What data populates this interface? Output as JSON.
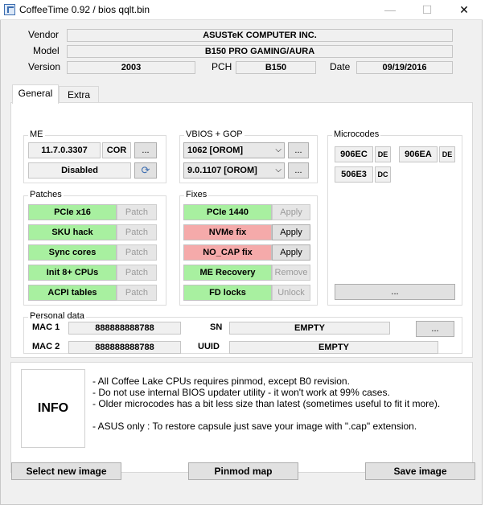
{
  "window": {
    "title": "CoffeeTime 0.92  /  bios qqlt.bin",
    "minimize_glyph": "—",
    "maximize_glyph": "☐",
    "close_glyph": "✕"
  },
  "header": {
    "vendor_label": "Vendor",
    "vendor_value": "ASUSTeK COMPUTER INC.",
    "model_label": "Model",
    "model_value": "B150 PRO GAMING/AURA",
    "version_label": "Version",
    "version_value": "2003",
    "pch_label": "PCH",
    "pch_value": "B150",
    "date_label": "Date",
    "date_value": "09/19/2016"
  },
  "tabs": [
    {
      "label": "General",
      "active": true
    },
    {
      "label": "Extra",
      "active": false
    }
  ],
  "me": {
    "title": "ME",
    "version": "11.7.0.3307",
    "type": "COR",
    "more_label": "...",
    "state": "Disabled",
    "refresh_icon": "⟳"
  },
  "vbios": {
    "title": "VBIOS + GOP",
    "vbios_value": "1062 [OROM]",
    "gop_value": "9.0.1107 [OROM]",
    "more_label": "...",
    "chevron": "⌵"
  },
  "microcodes": {
    "title": "Microcodes",
    "items": [
      {
        "cpuid": "906EC",
        "tag": "DE"
      },
      {
        "cpuid": "906EA",
        "tag": "DE"
      },
      {
        "cpuid": "506E3",
        "tag": "DC"
      }
    ],
    "more_label": "..."
  },
  "patches": {
    "title": "Patches",
    "items": [
      {
        "name": "PCIe x16",
        "action": "Patch"
      },
      {
        "name": "SKU hack",
        "action": "Patch"
      },
      {
        "name": "Sync cores",
        "action": "Patch"
      },
      {
        "name": "Init 8+ CPUs",
        "action": "Patch"
      },
      {
        "name": "ACPI tables",
        "action": "Patch"
      }
    ]
  },
  "fixes": {
    "title": "Fixes",
    "items": [
      {
        "name": "PCIe 1440",
        "action": "Apply",
        "status": "ok"
      },
      {
        "name": "NVMe fix",
        "action": "Apply",
        "status": "needed"
      },
      {
        "name": "NO_CAP fix",
        "action": "Apply",
        "status": "needed"
      },
      {
        "name": "ME Recovery",
        "action": "Remove",
        "status": "ok"
      },
      {
        "name": "FD locks",
        "action": "Unlock",
        "status": "ok"
      }
    ]
  },
  "personal": {
    "title": "Personal data",
    "mac1_label": "MAC 1",
    "mac1_value": "888888888788",
    "mac2_label": "MAC 2",
    "mac2_value": "888888888788",
    "sn_label": "SN",
    "sn_value": "EMPTY",
    "uuid_label": "UUID",
    "uuid_value": "EMPTY",
    "more_label": "..."
  },
  "info": {
    "label": "INFO",
    "lines": [
      "- All Coffee Lake CPUs requires pinmod, except B0 revision.",
      "- Do not use internal BIOS updater utility - it won't work at 99% cases.",
      "- Older microcodes has a bit less size than latest (sometimes useful to fit it more).",
      "- ASUS only : To restore capsule just save your image with \".cap\" extension."
    ]
  },
  "footer": {
    "select_label": "Select new image",
    "pinmod_label": "Pinmod map",
    "save_label": "Save image"
  },
  "colors": {
    "ok": "#a8f0a0",
    "needed": "#f5aaaa",
    "window_bg": "#f0f0f0"
  }
}
